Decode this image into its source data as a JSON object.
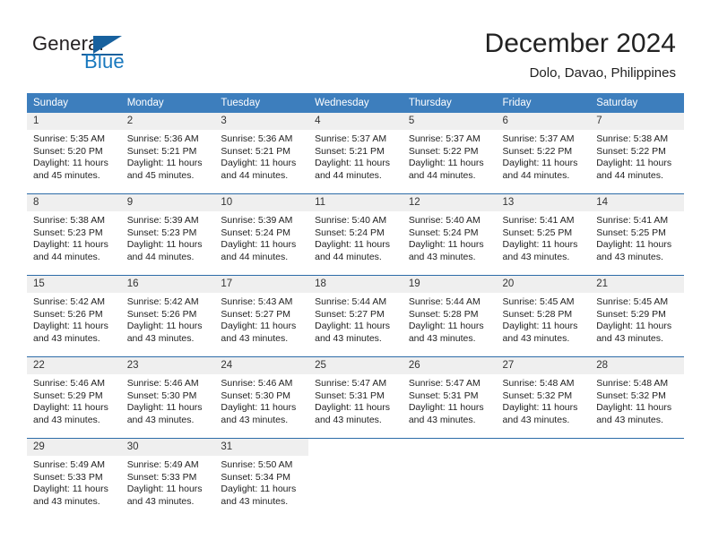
{
  "brand": {
    "name_part1": "General",
    "name_part2": "Blue",
    "logo_icon": "blue-triangle-flag-icon",
    "accent_color": "#17619e"
  },
  "header": {
    "title": "December 2024",
    "subtitle": "Dolo, Davao, Philippines"
  },
  "theme": {
    "header_bar_color": "#3d7ebd",
    "week_separator_color": "#2d6ca8",
    "daynum_background": "#efefef"
  },
  "weekdays": [
    "Sunday",
    "Monday",
    "Tuesday",
    "Wednesday",
    "Thursday",
    "Friday",
    "Saturday"
  ],
  "labels": {
    "sunrise_prefix": "Sunrise:",
    "sunset_prefix": "Sunset:",
    "daylight_prefix": "Daylight:"
  },
  "weeks": [
    [
      {
        "day": "1",
        "sunrise": "Sunrise: 5:35 AM",
        "sunset": "Sunset: 5:20 PM",
        "daylight1": "Daylight: 11 hours",
        "daylight2": "and 45 minutes."
      },
      {
        "day": "2",
        "sunrise": "Sunrise: 5:36 AM",
        "sunset": "Sunset: 5:21 PM",
        "daylight1": "Daylight: 11 hours",
        "daylight2": "and 45 minutes."
      },
      {
        "day": "3",
        "sunrise": "Sunrise: 5:36 AM",
        "sunset": "Sunset: 5:21 PM",
        "daylight1": "Daylight: 11 hours",
        "daylight2": "and 44 minutes."
      },
      {
        "day": "4",
        "sunrise": "Sunrise: 5:37 AM",
        "sunset": "Sunset: 5:21 PM",
        "daylight1": "Daylight: 11 hours",
        "daylight2": "and 44 minutes."
      },
      {
        "day": "5",
        "sunrise": "Sunrise: 5:37 AM",
        "sunset": "Sunset: 5:22 PM",
        "daylight1": "Daylight: 11 hours",
        "daylight2": "and 44 minutes."
      },
      {
        "day": "6",
        "sunrise": "Sunrise: 5:37 AM",
        "sunset": "Sunset: 5:22 PM",
        "daylight1": "Daylight: 11 hours",
        "daylight2": "and 44 minutes."
      },
      {
        "day": "7",
        "sunrise": "Sunrise: 5:38 AM",
        "sunset": "Sunset: 5:22 PM",
        "daylight1": "Daylight: 11 hours",
        "daylight2": "and 44 minutes."
      }
    ],
    [
      {
        "day": "8",
        "sunrise": "Sunrise: 5:38 AM",
        "sunset": "Sunset: 5:23 PM",
        "daylight1": "Daylight: 11 hours",
        "daylight2": "and 44 minutes."
      },
      {
        "day": "9",
        "sunrise": "Sunrise: 5:39 AM",
        "sunset": "Sunset: 5:23 PM",
        "daylight1": "Daylight: 11 hours",
        "daylight2": "and 44 minutes."
      },
      {
        "day": "10",
        "sunrise": "Sunrise: 5:39 AM",
        "sunset": "Sunset: 5:24 PM",
        "daylight1": "Daylight: 11 hours",
        "daylight2": "and 44 minutes."
      },
      {
        "day": "11",
        "sunrise": "Sunrise: 5:40 AM",
        "sunset": "Sunset: 5:24 PM",
        "daylight1": "Daylight: 11 hours",
        "daylight2": "and 44 minutes."
      },
      {
        "day": "12",
        "sunrise": "Sunrise: 5:40 AM",
        "sunset": "Sunset: 5:24 PM",
        "daylight1": "Daylight: 11 hours",
        "daylight2": "and 43 minutes."
      },
      {
        "day": "13",
        "sunrise": "Sunrise: 5:41 AM",
        "sunset": "Sunset: 5:25 PM",
        "daylight1": "Daylight: 11 hours",
        "daylight2": "and 43 minutes."
      },
      {
        "day": "14",
        "sunrise": "Sunrise: 5:41 AM",
        "sunset": "Sunset: 5:25 PM",
        "daylight1": "Daylight: 11 hours",
        "daylight2": "and 43 minutes."
      }
    ],
    [
      {
        "day": "15",
        "sunrise": "Sunrise: 5:42 AM",
        "sunset": "Sunset: 5:26 PM",
        "daylight1": "Daylight: 11 hours",
        "daylight2": "and 43 minutes."
      },
      {
        "day": "16",
        "sunrise": "Sunrise: 5:42 AM",
        "sunset": "Sunset: 5:26 PM",
        "daylight1": "Daylight: 11 hours",
        "daylight2": "and 43 minutes."
      },
      {
        "day": "17",
        "sunrise": "Sunrise: 5:43 AM",
        "sunset": "Sunset: 5:27 PM",
        "daylight1": "Daylight: 11 hours",
        "daylight2": "and 43 minutes."
      },
      {
        "day": "18",
        "sunrise": "Sunrise: 5:44 AM",
        "sunset": "Sunset: 5:27 PM",
        "daylight1": "Daylight: 11 hours",
        "daylight2": "and 43 minutes."
      },
      {
        "day": "19",
        "sunrise": "Sunrise: 5:44 AM",
        "sunset": "Sunset: 5:28 PM",
        "daylight1": "Daylight: 11 hours",
        "daylight2": "and 43 minutes."
      },
      {
        "day": "20",
        "sunrise": "Sunrise: 5:45 AM",
        "sunset": "Sunset: 5:28 PM",
        "daylight1": "Daylight: 11 hours",
        "daylight2": "and 43 minutes."
      },
      {
        "day": "21",
        "sunrise": "Sunrise: 5:45 AM",
        "sunset": "Sunset: 5:29 PM",
        "daylight1": "Daylight: 11 hours",
        "daylight2": "and 43 minutes."
      }
    ],
    [
      {
        "day": "22",
        "sunrise": "Sunrise: 5:46 AM",
        "sunset": "Sunset: 5:29 PM",
        "daylight1": "Daylight: 11 hours",
        "daylight2": "and 43 minutes."
      },
      {
        "day": "23",
        "sunrise": "Sunrise: 5:46 AM",
        "sunset": "Sunset: 5:30 PM",
        "daylight1": "Daylight: 11 hours",
        "daylight2": "and 43 minutes."
      },
      {
        "day": "24",
        "sunrise": "Sunrise: 5:46 AM",
        "sunset": "Sunset: 5:30 PM",
        "daylight1": "Daylight: 11 hours",
        "daylight2": "and 43 minutes."
      },
      {
        "day": "25",
        "sunrise": "Sunrise: 5:47 AM",
        "sunset": "Sunset: 5:31 PM",
        "daylight1": "Daylight: 11 hours",
        "daylight2": "and 43 minutes."
      },
      {
        "day": "26",
        "sunrise": "Sunrise: 5:47 AM",
        "sunset": "Sunset: 5:31 PM",
        "daylight1": "Daylight: 11 hours",
        "daylight2": "and 43 minutes."
      },
      {
        "day": "27",
        "sunrise": "Sunrise: 5:48 AM",
        "sunset": "Sunset: 5:32 PM",
        "daylight1": "Daylight: 11 hours",
        "daylight2": "and 43 minutes."
      },
      {
        "day": "28",
        "sunrise": "Sunrise: 5:48 AM",
        "sunset": "Sunset: 5:32 PM",
        "daylight1": "Daylight: 11 hours",
        "daylight2": "and 43 minutes."
      }
    ],
    [
      {
        "day": "29",
        "sunrise": "Sunrise: 5:49 AM",
        "sunset": "Sunset: 5:33 PM",
        "daylight1": "Daylight: 11 hours",
        "daylight2": "and 43 minutes."
      },
      {
        "day": "30",
        "sunrise": "Sunrise: 5:49 AM",
        "sunset": "Sunset: 5:33 PM",
        "daylight1": "Daylight: 11 hours",
        "daylight2": "and 43 minutes."
      },
      {
        "day": "31",
        "sunrise": "Sunrise: 5:50 AM",
        "sunset": "Sunset: 5:34 PM",
        "daylight1": "Daylight: 11 hours",
        "daylight2": "and 43 minutes."
      },
      {
        "day": "",
        "sunrise": "",
        "sunset": "",
        "daylight1": "",
        "daylight2": ""
      },
      {
        "day": "",
        "sunrise": "",
        "sunset": "",
        "daylight1": "",
        "daylight2": ""
      },
      {
        "day": "",
        "sunrise": "",
        "sunset": "",
        "daylight1": "",
        "daylight2": ""
      },
      {
        "day": "",
        "sunrise": "",
        "sunset": "",
        "daylight1": "",
        "daylight2": ""
      }
    ]
  ]
}
